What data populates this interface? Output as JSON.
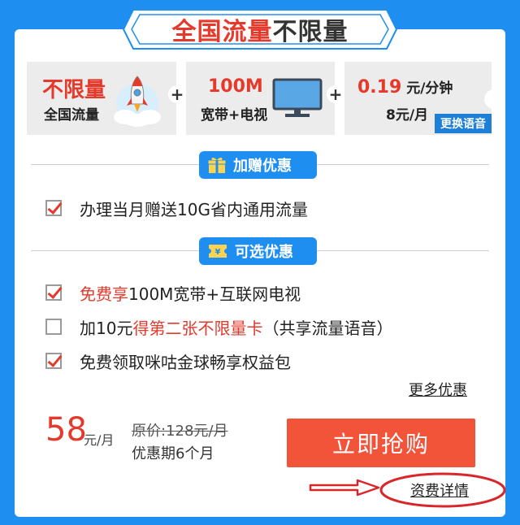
{
  "title": {
    "highlight": "全国流量",
    "rest": "不限量"
  },
  "plans": [
    {
      "main": "不限量",
      "sub": "全国流量",
      "icon": "rocket-icon"
    },
    {
      "main": "100M",
      "sub": "宽带+电视",
      "icon": "tv-icon"
    },
    {
      "main_value": "0.19",
      "main_unit": " 元/分钟",
      "sub": "8元/月",
      "badge": "更换语音"
    }
  ],
  "plus_symbol": "+",
  "section_gift": {
    "label": "加赠优惠",
    "icon": "gift-icon"
  },
  "gift_items": [
    {
      "text": "办理当月赠送10G省内通用流量",
      "checked": true
    }
  ],
  "section_optional": {
    "label": "可选优惠",
    "icon": "coupon-icon"
  },
  "optional_items": [
    {
      "highlight": "免费享",
      "text": "100M宽带+互联网电视",
      "checked": true
    },
    {
      "prefix": "加10元",
      "highlight": "得第二张不限量卡",
      "suffix": "（共享流量语音）",
      "checked": false
    },
    {
      "text": "免费领取咪咕金球畅享权益包",
      "checked": true
    }
  ],
  "more_link": "更多优惠",
  "price": {
    "amount": "58",
    "unit": "元/月",
    "original": "原价:128元/月",
    "promo_period": "优惠期6个月"
  },
  "buy_button": "立即抢购",
  "detail_link": "资费详情",
  "colors": {
    "accent": "#1e8ff0",
    "brand_red": "#e4392b",
    "button": "#f2543a"
  }
}
